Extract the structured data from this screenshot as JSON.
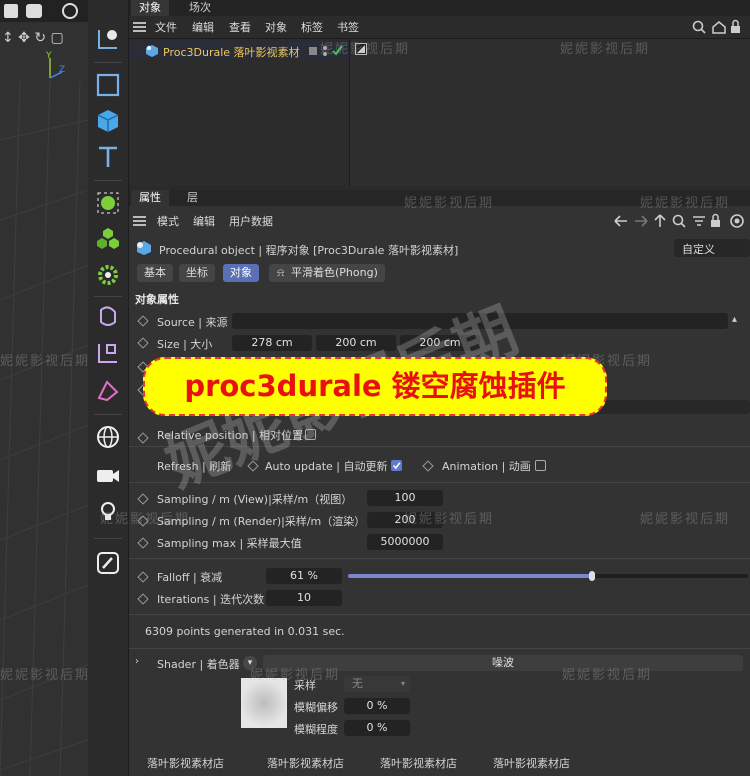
{
  "objects_panel": {
    "tabs": [
      "对象",
      "场次"
    ],
    "menu": [
      "文件",
      "编辑",
      "查看",
      "对象",
      "标签",
      "书签"
    ],
    "object_name": "Proc3Durale 落叶影视素材"
  },
  "attr_panel": {
    "tabs": [
      "属性",
      "层"
    ],
    "menu": [
      "模式",
      "编辑",
      "用户数据"
    ],
    "object_title": "Procedural object | 程序对象 [Proc3Durale 落叶影视素材]",
    "preset": "自定义",
    "subtabs": [
      "基本",
      "坐标",
      "对象",
      "平滑着色(Phong)"
    ],
    "section_title": "对象属性",
    "source_label": "Source | 来源",
    "size_label": "Size | 大小",
    "size_values": [
      "278 cm",
      "200 cm",
      "200 cm"
    ],
    "relative_label": "Relative position | 相对位置",
    "refresh_label": "Refresh | 刷新",
    "auto_update_label": "Auto update | 自动更新",
    "animation_label": "Animation | 动画",
    "sampling_view_label": "Sampling / m (View)|采样/m（视图）",
    "sampling_view_value": "100",
    "sampling_render_label": "Sampling / m (Render)|采样/m（渲染）",
    "sampling_render_value": "200",
    "sampling_max_label": "Sampling max | 采样最大值",
    "sampling_max_value": "5000000",
    "falloff_label": "Falloff | 衰减",
    "falloff_value": "61 %",
    "falloff_fraction": 0.61,
    "iterations_label": "Iterations | 迭代次数",
    "iterations_value": "10",
    "status": "6309 points generated in 0.031 sec.",
    "shader_label": "Shader | 着色器",
    "shader_name": "噪波",
    "sample_label": "采样",
    "sample_value": "无",
    "blur_offset_label": "模糊偏移",
    "blur_offset_value": "0 %",
    "blur_degree_label": "模糊程度",
    "blur_degree_value": "0 %"
  },
  "banner_text": "proc3durale  镂空腐蚀插件",
  "footer_stores": [
    "落叶影视素材店",
    "落叶影视素材店",
    "落叶影视素材店",
    "落叶影视素材店"
  ],
  "watermarks": [
    "妮妮影视后期",
    "妮妮影视后期",
    "妮妮影视后期",
    "妮妮影视后期",
    "妮妮影视后期",
    "妮妮影视后期",
    "妮妮影视后期",
    "妮妮影视后期",
    "妮妮影视后期",
    "妮妮影视后期",
    "妮妮影视后期",
    "妮妮影视后期"
  ],
  "big_watermark": "妮妮影视后期",
  "colors": {
    "accent": "#5a6fb4",
    "banner_bg": "#ffff00",
    "banner_text": "#e81010",
    "check": "#2ecc40"
  }
}
